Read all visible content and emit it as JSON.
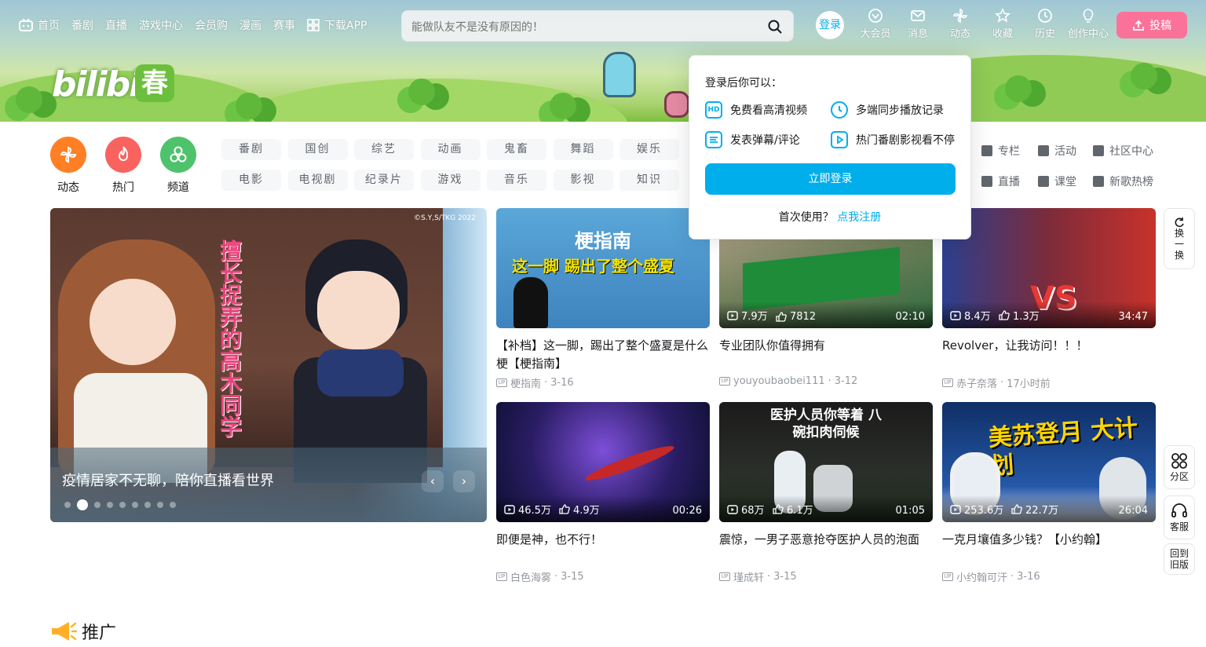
{
  "nav": {
    "items": [
      {
        "label": "首页",
        "icon": "tv-icon"
      },
      {
        "label": "番剧"
      },
      {
        "label": "直播"
      },
      {
        "label": "游戏中心"
      },
      {
        "label": "会员购"
      },
      {
        "label": "漫画"
      },
      {
        "label": "赛事"
      },
      {
        "label": "下载APP",
        "icon": "qr-icon"
      }
    ],
    "search_placeholder": "能做队友不是没有原因的！",
    "login_label": "登录",
    "right_items": [
      {
        "label": "大会员",
        "icon": "vip-icon"
      },
      {
        "label": "消息",
        "icon": "mail-icon"
      },
      {
        "label": "动态",
        "icon": "windmill-icon"
      },
      {
        "label": "收藏",
        "icon": "star-icon"
      },
      {
        "label": "历史",
        "icon": "clock-icon"
      },
      {
        "label": "创作中心",
        "icon": "bulb-icon"
      }
    ],
    "upload_label": "投稿"
  },
  "logo": {
    "text": "bilibili",
    "sub": "春"
  },
  "channels": [
    {
      "label": "动态",
      "color": "#ff7f24"
    },
    {
      "label": "热门",
      "color": "#f9625f"
    },
    {
      "label": "频道",
      "color": "#4fc26c"
    }
  ],
  "tags": [
    "番剧",
    "国创",
    "综艺",
    "动画",
    "鬼畜",
    "舞蹈",
    "娱乐",
    "电影",
    "电视剧",
    "纪录片",
    "游戏",
    "音乐",
    "影视",
    "知识"
  ],
  "links": [
    {
      "label": "专栏"
    },
    {
      "label": "活动"
    },
    {
      "label": "社区中心"
    },
    {
      "label": "直播"
    },
    {
      "label": "课堂"
    },
    {
      "label": "新歌热榜"
    }
  ],
  "carousel": {
    "title": "疫情居家不无聊，陪你直播看世界",
    "image_title": "擅长捉弄的高木同学",
    "image_copyright": "©S.Y,S/TKG 2022",
    "dots": 9,
    "active_dot": 1,
    "prev": "‹",
    "next": "›"
  },
  "cards": [
    {
      "title": "【补档】这一脚，踢出了整个盛夏是什么梗【梗指南】",
      "author": "梗指南",
      "date": "3-16",
      "views": "",
      "likes": "",
      "duration": "",
      "overlay": "梗指南",
      "overlay2": "这一脚 踢出了整个盛夏"
    },
    {
      "title": "专业团队你值得拥有",
      "author": "youyoubaobei111",
      "date": "3-12",
      "views": "7.9万",
      "likes": "7812",
      "duration": "02:10"
    },
    {
      "title": "Revolver，让我访问！！！",
      "author": "赤子奈落",
      "date": "17小时前",
      "views": "8.4万",
      "likes": "1.3万",
      "duration": "34:47",
      "overlay": "VS"
    },
    {
      "title": "即便是神，也不行！",
      "author": "白色海雾",
      "date": "3-15",
      "views": "46.5万",
      "likes": "4.9万",
      "duration": "00:26"
    },
    {
      "title": "震惊，一男子恶意抢夺医护人员的泡面",
      "author": "瑾成轩",
      "date": "3-15",
      "views": "68万",
      "likes": "6.1万",
      "duration": "01:05",
      "overlay": "医护人员你等着 八碗扣肉伺候"
    },
    {
      "title": "一克月壤值多少钱？【小约翰】",
      "author": "小约翰可汗",
      "date": "3-16",
      "views": "253.6万",
      "likes": "22.7万",
      "duration": "26:04",
      "overlay": "美苏登月 大计划"
    }
  ],
  "popup": {
    "heading": "登录后你可以：",
    "features": [
      {
        "label": "免费看高清视频",
        "icon": "hd-icon",
        "glyph": "HD"
      },
      {
        "label": "多端同步播放记录",
        "icon": "clock-icon"
      },
      {
        "label": "发表弹幕/评论",
        "icon": "danmaku-icon"
      },
      {
        "label": "热门番剧影视看不停",
        "icon": "play-icon"
      }
    ],
    "login_button": "立即登录",
    "first_use": "首次使用？",
    "register": "点我注册"
  },
  "side": {
    "refresh": "换一换",
    "zones": "分区",
    "service": "客服",
    "old": "回到旧版"
  },
  "promo_label": "推广"
}
